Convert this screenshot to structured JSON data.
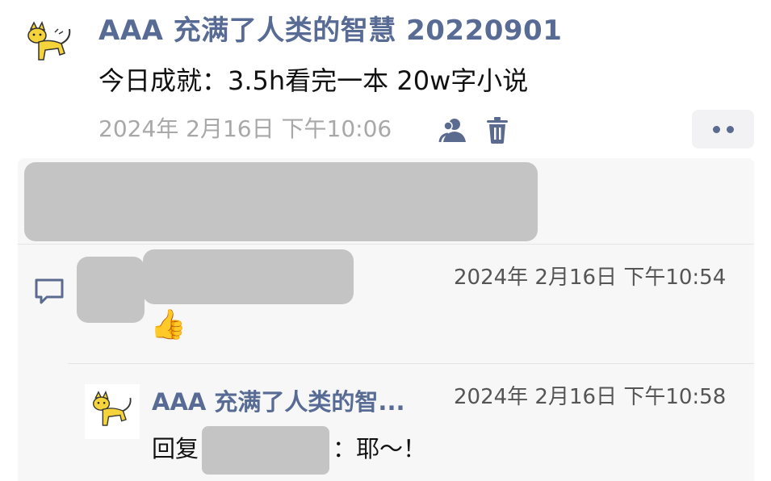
{
  "post": {
    "author": "AAA 充满了人类的智慧 20220901",
    "text": "今日成就：3.5h看完一本 20w字小说",
    "timestamp": "2024年 2月16日 下午10:06",
    "icons": {
      "visibility": "people-icon",
      "delete": "trash-icon",
      "more": "more-dots-icon"
    }
  },
  "comments": [
    {
      "timestamp": "2024年 2月16日 下午10:54",
      "content_emoji": "👍"
    }
  ],
  "replies": [
    {
      "author": "AAA 充满了人类的智...",
      "prefix": "回复",
      "suffix": "：耶～！",
      "timestamp": "2024年 2月16日 下午10:58"
    }
  ],
  "colors": {
    "link": "#576b95",
    "time": "#a8a8a8",
    "panel": "#f7f7f7",
    "redaction": "#c4c4c4"
  }
}
